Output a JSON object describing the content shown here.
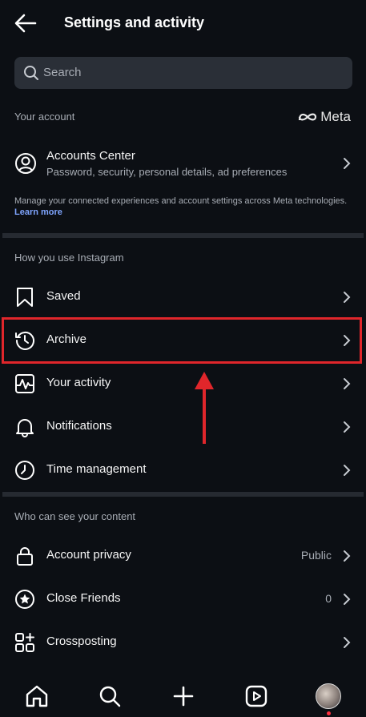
{
  "header": {
    "title": "Settings and activity"
  },
  "search": {
    "placeholder": "Search"
  },
  "your_account": {
    "section_title": "Your account",
    "brand": "Meta",
    "accounts_center": {
      "label": "Accounts Center",
      "subtitle": "Password, security, personal details, ad preferences"
    },
    "note": "Manage your connected experiences and account settings across Meta technologies.",
    "note_link": "Learn more"
  },
  "how_you_use": {
    "section_title": "How you use Instagram",
    "items": [
      {
        "label": "Saved",
        "icon": "bookmark-icon"
      },
      {
        "label": "Archive",
        "icon": "archive-icon"
      },
      {
        "label": "Your activity",
        "icon": "activity-icon"
      },
      {
        "label": "Notifications",
        "icon": "bell-icon"
      },
      {
        "label": "Time management",
        "icon": "clock-icon"
      }
    ]
  },
  "who_can_see": {
    "section_title": "Who can see your content",
    "items": [
      {
        "label": "Account privacy",
        "value": "Public",
        "icon": "lock-icon"
      },
      {
        "label": "Close Friends",
        "value": "0",
        "icon": "star-icon"
      },
      {
        "label": "Crossposting",
        "icon": "crosspost-icon"
      }
    ]
  },
  "annotation": {
    "highlight_color": "#e0262b"
  },
  "bottom_nav": [
    "home-icon",
    "search-icon",
    "create-icon",
    "reels-icon",
    "profile-avatar"
  ]
}
